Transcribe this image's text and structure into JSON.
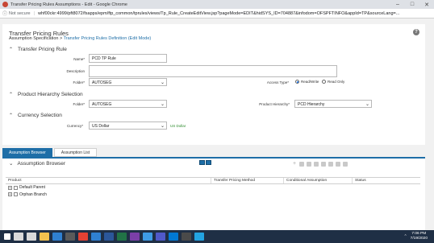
{
  "browser": {
    "window_title": "Transfer Pricing Rules Assumptions - Edit - Google Chrome",
    "security_label": "Not secure",
    "url": "whf00ckr:4999/pft8072/fsapps/epm/ftp_common/tprules/views/Tp_Rule_CreateEditView.jsp?pageMode=EDIT&hidSYS_ID=704887&infodom=OFSPFTINFO&appId=TP&sourceLang=..."
  },
  "page": {
    "title": "Transfer Pricing Rules",
    "breadcrumb": {
      "root": "Assumption Specification",
      "separator": ">",
      "current": "Transfer Pricing Rules Definition (Edit Mode)"
    },
    "help_label": "?"
  },
  "rule_section": {
    "heading": "Transfer Pricing Rule",
    "name_label": "Name*",
    "name_value": "PCD TP Rule",
    "description_label": "Description",
    "description_value": "",
    "folder_label": "Folder*",
    "folder_value": "AUTOSEG",
    "access_label": "Access Type*",
    "access_options": [
      "Read/Write",
      "Read Only"
    ],
    "access_selected": "Read/Write"
  },
  "hierarchy_section": {
    "heading": "Product Hierarchy Selection",
    "folder_label": "Folder*",
    "folder_value": "AUTOSEG",
    "hierarchy_label": "Product Hierarchy*",
    "hierarchy_value": "PCD Hierarchy"
  },
  "currency_section": {
    "heading": "Currency Selection",
    "currency_label": "Currency*",
    "currency_value": "US Dollar",
    "currency_code_label": "US Dollar"
  },
  "tabs": [
    {
      "label": "Assumption Browser",
      "active": true
    },
    {
      "label": "Assumption List",
      "active": false
    }
  ],
  "assumption_browser": {
    "heading": "Assumption Browser",
    "columns": [
      "Product",
      "Transfer Pricing Method",
      "Conditional Assumption",
      "Status"
    ],
    "rows": [
      {
        "product": "Default Parent",
        "method": "",
        "conditional": "",
        "status": ""
      },
      {
        "product": "Orphan Branch",
        "method": "",
        "conditional": "",
        "status": ""
      }
    ]
  },
  "taskbar": {
    "time": "7:06 PM",
    "date": "7/19/2020",
    "icon_names": [
      "windows-start-icon",
      "search-icon",
      "task-view-icon",
      "file-explorer-icon",
      "edge-icon",
      "store-icon",
      "chrome-icon",
      "mail-icon",
      "word-icon",
      "excel-icon",
      "onenote-icon",
      "photos-icon",
      "teams-icon",
      "outlook-icon",
      "terminal-icon",
      "vscode-icon"
    ],
    "icon_colors": [
      "#ffffff",
      "#d9d9d9",
      "#d9d9d9",
      "#f2c14e",
      "#2f80d1",
      "#5a5a5a",
      "#e34133",
      "#2f80d1",
      "#2b579a",
      "#217346",
      "#7b3fa8",
      "#3e9ce6",
      "#5059c9",
      "#0078d4",
      "#4a4a4a",
      "#23a3e1"
    ]
  },
  "colors": {
    "accent": "#1e6ea7",
    "tab_active_bg": "#1e6ea7",
    "currency_code": "#2b8a2b",
    "taskbar_bg": "#1f2f45"
  }
}
